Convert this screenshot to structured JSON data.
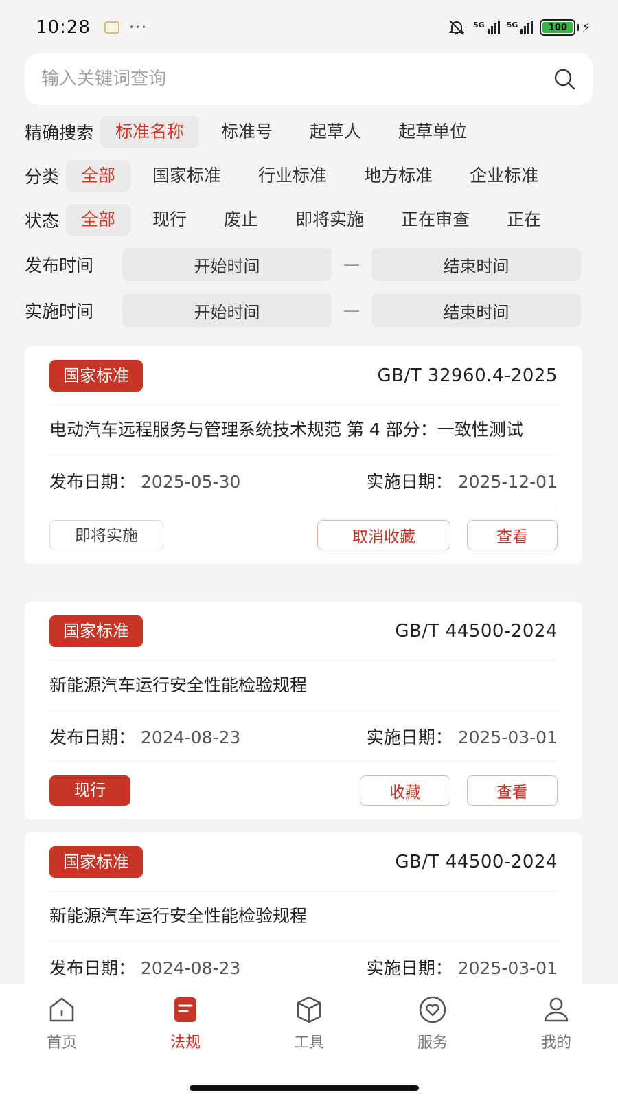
{
  "status_bar": {
    "time": "10:28",
    "more": "···",
    "signal_1": "5G",
    "signal_2": "5G",
    "battery": "100"
  },
  "search": {
    "placeholder": "输入关键词查询"
  },
  "filters": {
    "exact_search": {
      "label": "精确搜索",
      "options": [
        "标准名称",
        "标准号",
        "起草人",
        "起草单位"
      ],
      "selected": "标准名称"
    },
    "category": {
      "label": "分类",
      "options": [
        "全部",
        "国家标准",
        "行业标准",
        "地方标准",
        "企业标准"
      ],
      "selected": "全部"
    },
    "status": {
      "label": "状态",
      "options": [
        "全部",
        "现行",
        "废止",
        "即将实施",
        "正在审查",
        "正在"
      ],
      "selected": "全部"
    },
    "publish_time": {
      "label": "发布时间",
      "start": "开始时间",
      "separator": "—",
      "end": "结束时间"
    },
    "implement_time": {
      "label": "实施时间",
      "start": "开始时间",
      "separator": "—",
      "end": "结束时间"
    }
  },
  "results": [
    {
      "type": "国家标准",
      "number": "GB/T 32960.4-2025",
      "title": "电动汽车远程服务与管理系统技术规范 第 4 部分：一致性测试",
      "publish_label": "发布日期：",
      "publish_date": "2025-05-30",
      "implement_label": "实施日期：",
      "implement_date": "2025-12-01",
      "status": "即将实施",
      "favorite_action": "取消收藏",
      "view_action": "查看"
    },
    {
      "type": "国家标准",
      "number": "GB/T 44500-2024",
      "title": "新能源汽车运行安全性能检验规程",
      "publish_label": "发布日期：",
      "publish_date": "2024-08-23",
      "implement_label": "实施日期：",
      "implement_date": "2025-03-01",
      "status": "现行",
      "favorite_action": "收藏",
      "view_action": "查看"
    },
    {
      "type": "国家标准",
      "number": "GB/T 44500-2024",
      "title": "新能源汽车运行安全性能检验规程",
      "publish_label": "发布日期：",
      "publish_date": "2024-08-23",
      "implement_label": "实施日期：",
      "implement_date": "2025-03-01"
    }
  ],
  "bottom_nav": {
    "items": [
      {
        "label": "首页",
        "icon": "home-icon"
      },
      {
        "label": "法规",
        "icon": "regulations-icon"
      },
      {
        "label": "工具",
        "icon": "box-icon"
      },
      {
        "label": "服务",
        "icon": "heart-icon"
      },
      {
        "label": "我的",
        "icon": "user-icon"
      }
    ],
    "active": "法规"
  },
  "colors": {
    "accent": "#c73527",
    "selected_chip_text": "#d23a2a",
    "background": "#f4f4f4"
  }
}
